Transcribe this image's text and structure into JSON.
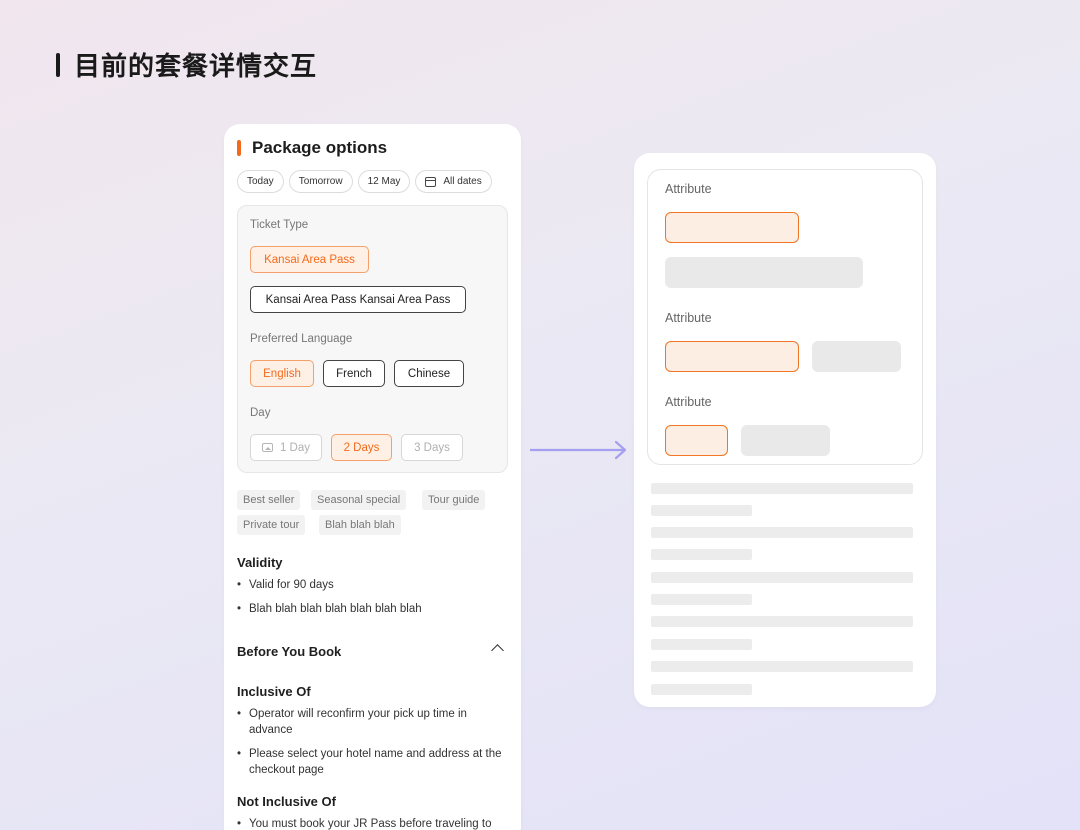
{
  "page": {
    "heading": "目前的套餐详情交互"
  },
  "left_card": {
    "title": "Package options",
    "date_chips": [
      "Today",
      "Tomorrow",
      "12 May",
      "All dates"
    ],
    "ticket_type": {
      "label": "Ticket Type",
      "options": [
        "Kansai Area Pass",
        "Kansai Area Pass Kansai Area Pass"
      ],
      "selected": "Kansai Area Pass"
    },
    "preferred_language": {
      "label": "Preferred Language",
      "options": [
        "English",
        "French",
        "Chinese"
      ],
      "selected": "English"
    },
    "day": {
      "label": "Day",
      "options": [
        "1 Day",
        "2 Days",
        "3 Days"
      ],
      "selected": "2 Days",
      "disabled": [
        "1 Day",
        "3 Days"
      ]
    },
    "tags": [
      "Best seller",
      "Seasonal special",
      "Tour guide",
      "Private tour",
      "Blah blah blah"
    ],
    "validity": {
      "title": "Validity",
      "items": [
        "Valid for 90 days",
        "Blah blah blah blah blah blah blah"
      ]
    },
    "before_you_book": {
      "title": "Before You Book"
    },
    "inclusive_of": {
      "title": "Inclusive Of",
      "items": [
        "Operator will reconfirm your pick up time in advance",
        "Please select your hotel name and address at the checkout page"
      ]
    },
    "not_inclusive_of": {
      "title": "Not Inclusive Of",
      "items": [
        "You must book your JR Pass before traveling to"
      ]
    }
  },
  "right_card": {
    "attribute_labels": [
      "Attribute",
      "Attribute",
      "Attribute"
    ]
  },
  "colors": {
    "accent": "#f26b1d",
    "selected_bg": "#fff0e5",
    "placeholder": "#e9e9e9",
    "arrow": "#a59ff0"
  }
}
